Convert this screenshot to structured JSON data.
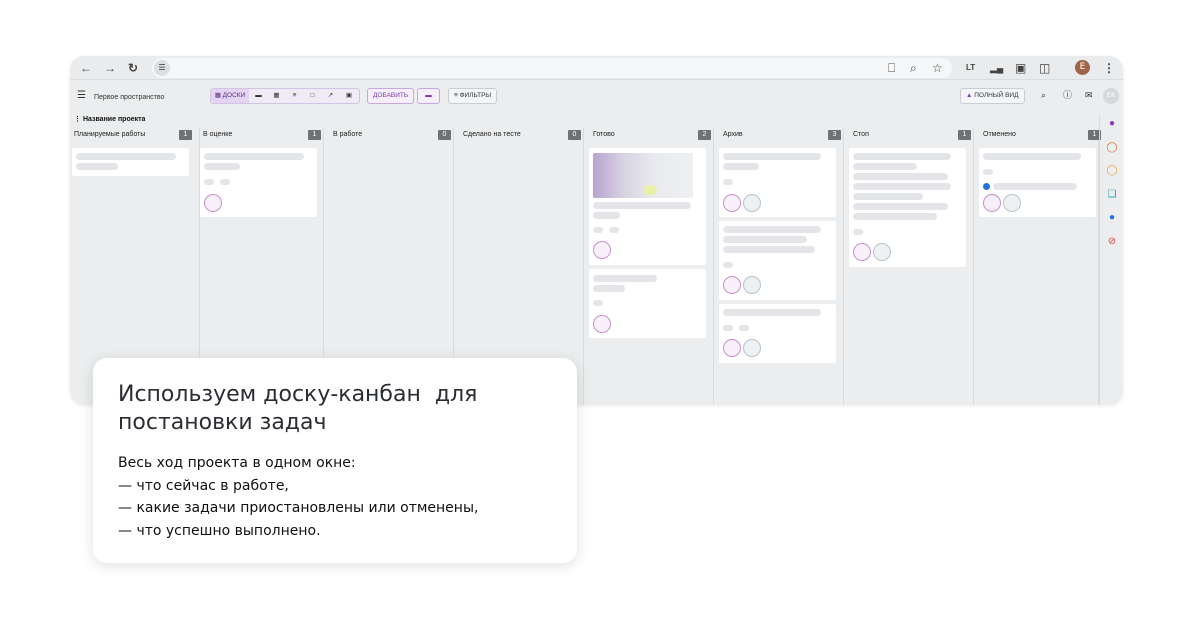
{
  "browser": {
    "icons": [
      "back-icon",
      "forward-icon",
      "reload-icon",
      "site-info-icon",
      "cast-icon",
      "zoom-icon",
      "star-icon",
      "extension-lt-icon",
      "signal-icon",
      "camera-icon",
      "puzzle-icon",
      "menu-icon"
    ],
    "profile_initial": "E"
  },
  "toolbar": {
    "workspace": "Первое пространство",
    "view_boards": "ДОСКИ",
    "add_label": "ДОБАВИТЬ",
    "filters_label": "ФИЛЬТРЫ",
    "full_view_label": "ПОЛНЫЙ ВИД",
    "user_initials": "ЕК"
  },
  "project": {
    "title": "Название проекта"
  },
  "columns": [
    {
      "title": "Планируемые работы",
      "count": "1"
    },
    {
      "title": "В оценке",
      "count": "1"
    },
    {
      "title": "В работе",
      "count": "0"
    },
    {
      "title": "Сделано на тесте",
      "count": "0"
    },
    {
      "title": "Готово",
      "count": "2"
    },
    {
      "title": "Архив",
      "count": "3"
    },
    {
      "title": "Стоп",
      "count": "1"
    },
    {
      "title": "Отменено",
      "count": "1"
    }
  ],
  "overlay": {
    "heading_line1": "Используем доску-канбан  для",
    "heading_line2": "постановки задач",
    "lines": [
      "Весь ход проекта в одном окне:",
      "— что сейчас в работе,",
      "— какие задачи приостановлены или отменены,",
      "— что успешно выполнено."
    ]
  },
  "colors": {
    "accent": "#7a3aa6",
    "count_badge": "#6e7277",
    "board_bg": "#ebedee"
  }
}
